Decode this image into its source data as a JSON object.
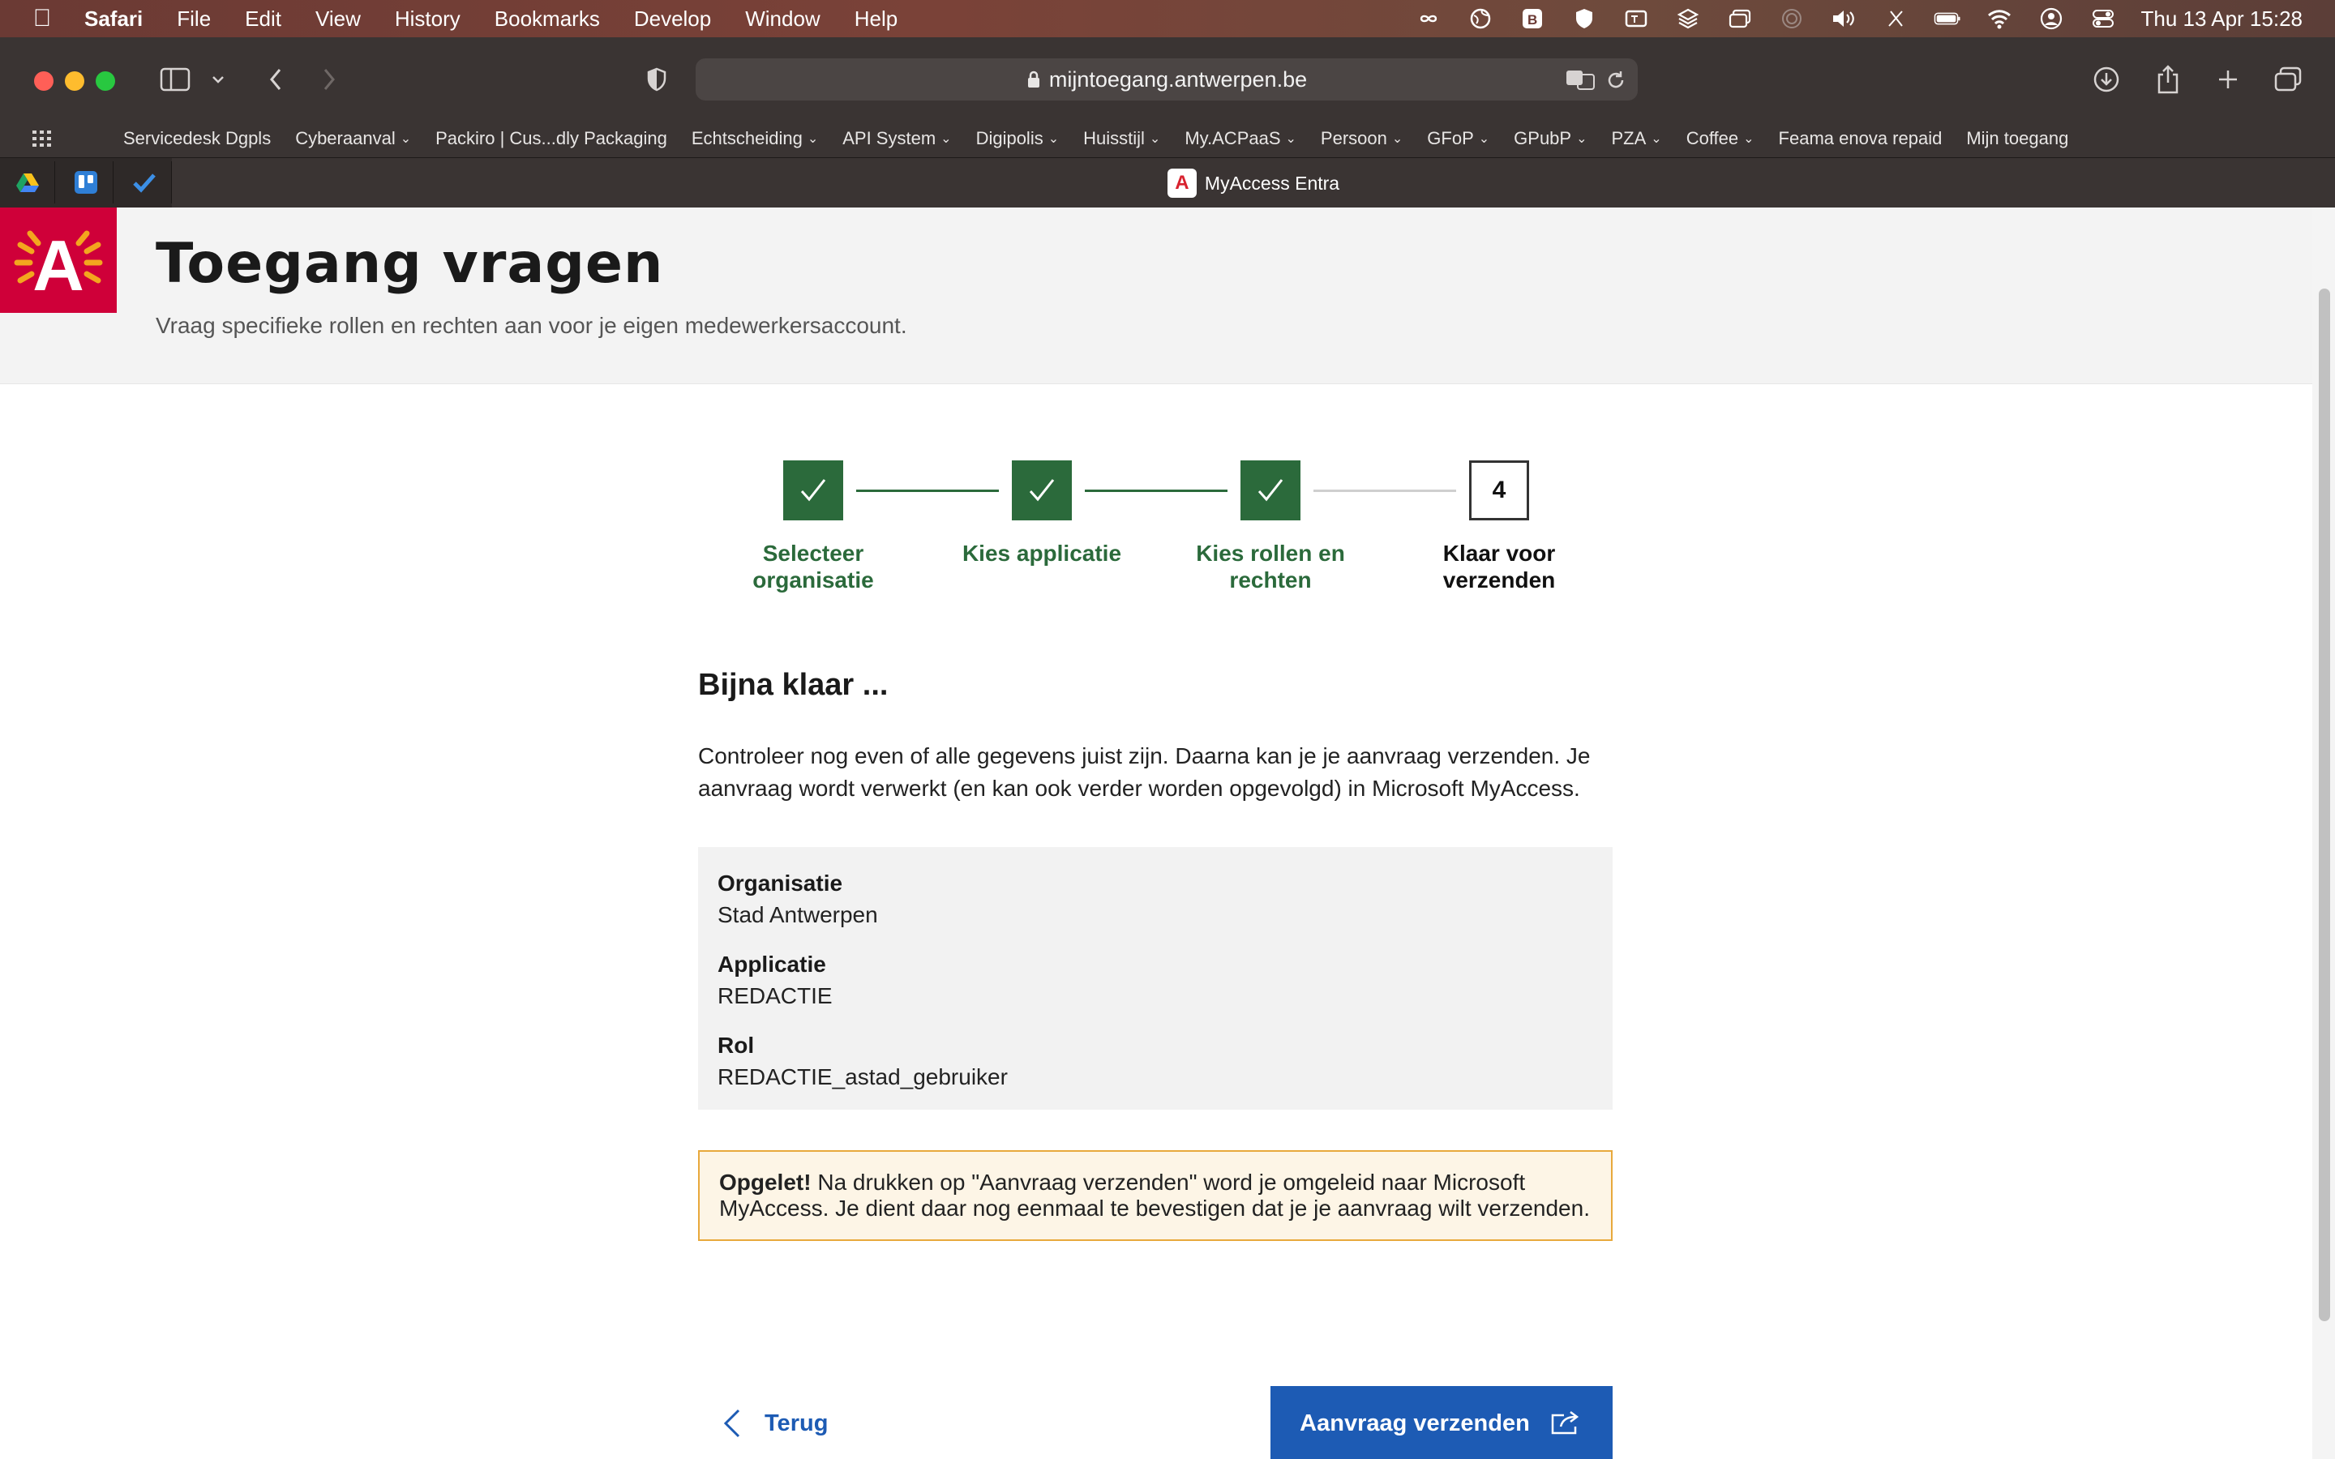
{
  "menubar": {
    "app": "Safari",
    "items": [
      "File",
      "Edit",
      "View",
      "History",
      "Bookmarks",
      "Develop",
      "Window",
      "Help"
    ],
    "clock": "Thu 13 Apr  15:28"
  },
  "browser": {
    "url": "mijntoegang.antwerpen.be",
    "bookmarks": [
      {
        "label": "Servicedesk Dgpls",
        "menu": false
      },
      {
        "label": "Cyberaanval",
        "menu": true
      },
      {
        "label": "Packiro | Cus...dly Packaging",
        "menu": false
      },
      {
        "label": "Echtscheiding",
        "menu": true
      },
      {
        "label": "API System",
        "menu": true
      },
      {
        "label": "Digipolis",
        "menu": true
      },
      {
        "label": "Huisstijl",
        "menu": true
      },
      {
        "label": "My.ACPaaS",
        "menu": true
      },
      {
        "label": "Persoon",
        "menu": true
      },
      {
        "label": "GFoP",
        "menu": true
      },
      {
        "label": "GPubP",
        "menu": true
      },
      {
        "label": "PZA",
        "menu": true
      },
      {
        "label": "Coffee",
        "menu": true
      },
      {
        "label": "Feama enova repaid",
        "menu": false
      },
      {
        "label": "Mijn toegang",
        "menu": false
      }
    ],
    "active_tab": "MyAccess Entra",
    "favicon_letter": "A"
  },
  "header": {
    "logo_letter": "A",
    "title": "Toegang vragen",
    "subtitle": "Vraag specifieke rollen en rechten aan voor je eigen medewerkersaccount."
  },
  "stepper": {
    "steps": [
      {
        "label_line1": "Selecteer",
        "label_line2": "organisatie",
        "status": "done"
      },
      {
        "label_line1": "Kies applicatie",
        "label_line2": "",
        "status": "done"
      },
      {
        "label_line1": "Kies rollen en",
        "label_line2": "rechten",
        "status": "done"
      },
      {
        "label_line1": "Klaar voor",
        "label_line2": "verzenden",
        "status": "current",
        "number": "4"
      }
    ]
  },
  "content": {
    "heading": "Bijna klaar ...",
    "intro": "Controleer nog even of alle gegevens juist zijn. Daarna kan je je aanvraag verzenden. Je aanvraag wordt verwerkt (en kan ook verder worden opgevolgd) in Microsoft MyAccess.",
    "summary": [
      {
        "label": "Organisatie",
        "value": "Stad Antwerpen"
      },
      {
        "label": "Applicatie",
        "value": "REDACTIE"
      },
      {
        "label": "Rol",
        "value": "REDACTIE_astad_gebruiker"
      }
    ],
    "warning_bold": "Opgelet!",
    "warning_text": " Na drukken op \"Aanvraag verzenden\" word je omgeleid naar Microsoft MyAccess. Je dient daar nog eenmaal te bevestigen dat je je aanvraag wilt verzenden."
  },
  "actions": {
    "back_label": "Terug",
    "submit_label": "Aanvraag verzenden"
  },
  "colors": {
    "brand_red": "#cf0039",
    "step_done": "#2b6a3b",
    "primary_blue": "#1d5bb4",
    "warning_border": "#e8a93c"
  }
}
